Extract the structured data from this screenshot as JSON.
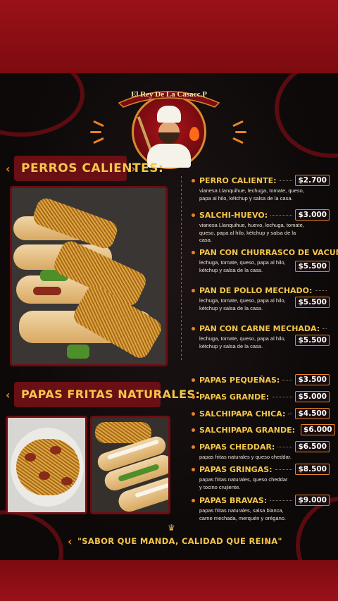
{
  "brand": {
    "name": "El Rey De La Casacc.P"
  },
  "sections": {
    "hotdogs_title": "PERROS CALIENTES:",
    "fries_title": "PAPAS FRITAS NATURALES:"
  },
  "hotdogs": [
    {
      "name": "PERRO CALIENTE:",
      "price": "$2.700",
      "desc": "vianesa Llanquihue, lechuga, tomate, queso, papa al hilo, kétchup y salsa de la casa."
    },
    {
      "name": "SALCHI-HUEVO:",
      "price": "$3.000",
      "desc": "vianesa Llanquihue, huevo, lechuga, tomate, queso, papa al hilo, kétchup y salsa de la casa."
    },
    {
      "name": "PAN CON CHURRASCO DE VACUN:",
      "price": "$5.500",
      "desc": "lechuga, tomate, queso, papa al hilo, kétchup y salsa de la casa."
    },
    {
      "name": "PAN DE POLLO MECHADO:",
      "price": "$5.500",
      "desc": "lechuga, tomate, queso, papa al hilo, kétchup y salsa de la casa."
    },
    {
      "name": "PAN CON CARNE MECHADA:",
      "price": "$5.500",
      "desc": "lechuga, tomate, queso, papa al hilo, kétchup y salsa de la casa."
    }
  ],
  "fries": [
    {
      "name": "PAPAS PEQUEÑAS:",
      "price": "$3.500",
      "desc": ""
    },
    {
      "name": "PAPAS GRANDE:",
      "price": "$5.000",
      "desc": ""
    },
    {
      "name": "SALCHIPAPA CHICA:",
      "price": "$4.500",
      "desc": ""
    },
    {
      "name": "SALCHIPAPA GRANDE:",
      "price": "$6.000",
      "desc": ""
    },
    {
      "name": "PAPAS CHEDDAR:",
      "price": "$6.500",
      "desc": "papas fritas naturales y queso cheddar."
    },
    {
      "name": "PAPAS GRINGAS:",
      "price": "$8.500",
      "desc": "papas fritas naturales, queso cheddar y tocino crujiente."
    },
    {
      "name": "PAPAS BRAVAS:",
      "price": "$9.000",
      "desc": "papas fritas naturales, salsa blanca, carne mechada, merquén y orégano."
    }
  ],
  "slogan": "\"SABOR QUE MANDA, CALIDAD QUE REINA\"",
  "colors": {
    "accent": "#f4c64a",
    "orange": "#e9822a",
    "red": "#8e0f14",
    "dark": "#0d0909"
  }
}
